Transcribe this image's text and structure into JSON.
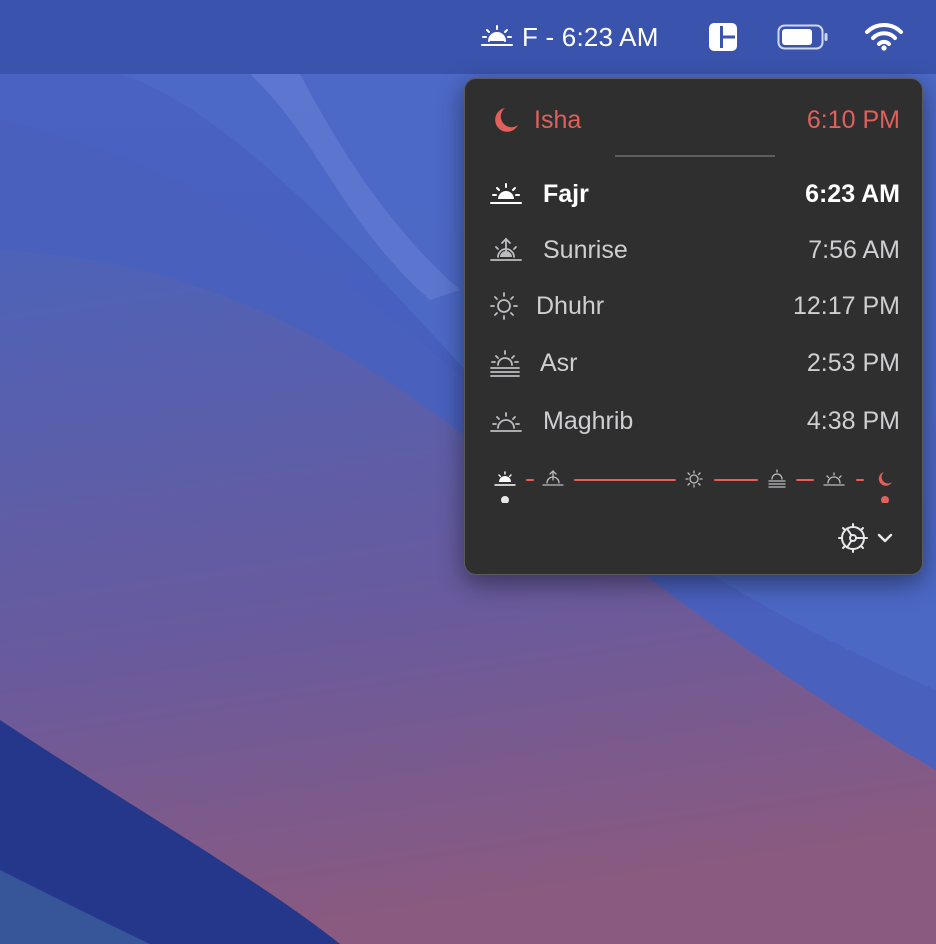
{
  "menubar": {
    "prayer_indicator": "F - 6:23 AM",
    "icons": [
      "fajr-icon",
      "window-layout-icon",
      "battery-icon",
      "wifi-icon"
    ]
  },
  "popover": {
    "previous": {
      "name": "Isha",
      "time": "6:10 PM",
      "icon": "crescent-moon-icon"
    },
    "prayers": [
      {
        "name": "Fajr",
        "time": "6:23 AM",
        "icon": "fajr-icon",
        "current": true
      },
      {
        "name": "Sunrise",
        "time": "7:56 AM",
        "icon": "sunrise-icon"
      },
      {
        "name": "Dhuhr",
        "time": "12:17 PM",
        "icon": "sun-icon"
      },
      {
        "name": "Asr",
        "time": "2:53 PM",
        "icon": "asr-icon"
      },
      {
        "name": "Maghrib",
        "time": "4:38 PM",
        "icon": "sunset-icon"
      }
    ],
    "timeline_icons": [
      "fajr-icon",
      "sunrise-icon",
      "sun-icon",
      "asr-icon",
      "sunset-icon",
      "crescent-moon-icon"
    ],
    "settings_icon": "gear-icon",
    "settings_menu_icon": "chevron-down-icon"
  },
  "colors": {
    "accent_red": "#e0615b",
    "popover_bg": "#2f2f30",
    "menubar_bg": "#3a54ad"
  }
}
